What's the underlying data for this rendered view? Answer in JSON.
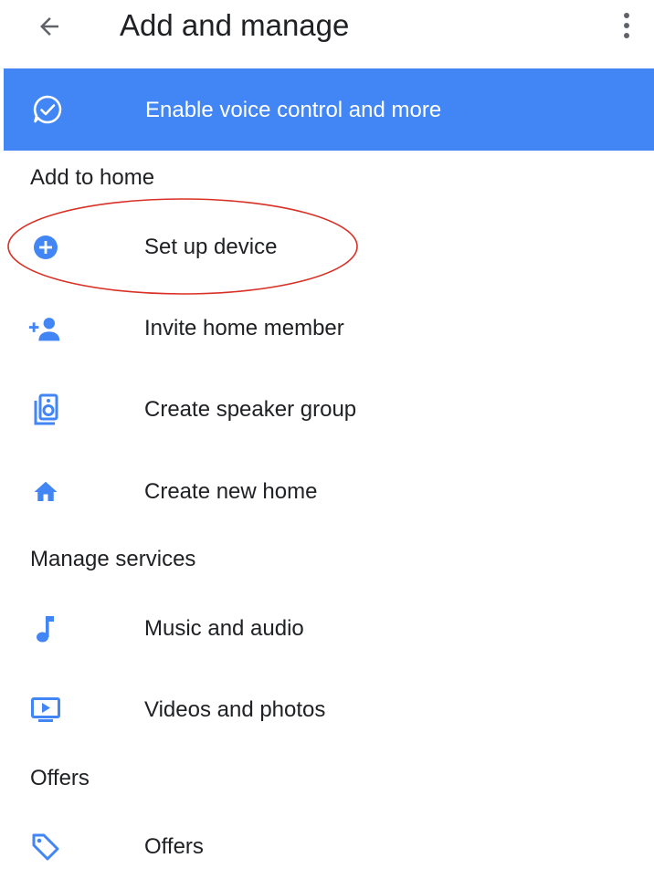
{
  "header": {
    "title": "Add and manage",
    "back_icon": "arrow-back-icon",
    "overflow_icon": "more-vert-icon"
  },
  "banner": {
    "label": "Enable voice control and more",
    "icon": "voice-check-icon",
    "color": "#4285f4"
  },
  "sections": {
    "add_to_home": {
      "header": "Add to home",
      "items": [
        {
          "label": "Set up device",
          "icon": "add-circle-icon"
        },
        {
          "label": "Invite home member",
          "icon": "person-add-icon"
        },
        {
          "label": "Create speaker group",
          "icon": "speaker-group-icon"
        },
        {
          "label": "Create new home",
          "icon": "home-icon"
        }
      ]
    },
    "manage_services": {
      "header": "Manage services",
      "items": [
        {
          "label": "Music and audio",
          "icon": "music-note-icon"
        },
        {
          "label": "Videos and photos",
          "icon": "video-display-icon"
        }
      ]
    },
    "offers": {
      "header": "Offers",
      "items": [
        {
          "label": "Offers",
          "icon": "tag-icon"
        }
      ]
    }
  },
  "colors": {
    "accent": "#4285f4",
    "annotation": "#d93025",
    "text": "#202124"
  }
}
